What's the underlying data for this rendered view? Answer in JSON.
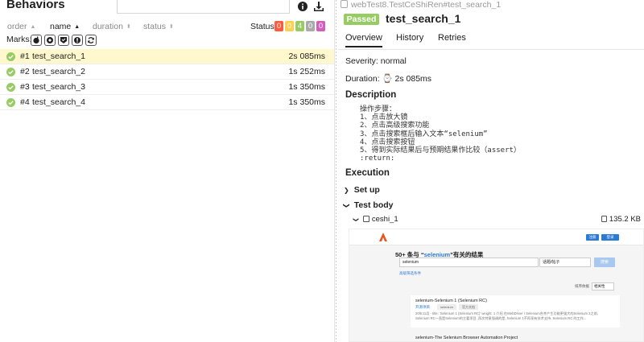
{
  "left": {
    "title": "Behaviors",
    "sort": {
      "order": "order",
      "name": "name",
      "duration": "duration",
      "status": "status"
    },
    "status_label": "Status:",
    "status_counts": [
      {
        "value": "0",
        "color": "#fd5a3e"
      },
      {
        "value": "0",
        "color": "#ffd050"
      },
      {
        "value": "4",
        "color": "#97cc64"
      },
      {
        "value": "0",
        "color": "#aaaaaa"
      },
      {
        "value": "0",
        "color": "#d35ebe"
      }
    ],
    "marks_label": "Marks:",
    "tests": [
      {
        "num": "#1",
        "name": "test_search_1",
        "duration": "2s 085ms",
        "selected": true
      },
      {
        "num": "#2",
        "name": "test_search_2",
        "duration": "1s 252ms",
        "selected": false
      },
      {
        "num": "#3",
        "name": "test_search_3",
        "duration": "1s 350ms",
        "selected": false
      },
      {
        "num": "#4",
        "name": "test_search_4",
        "duration": "1s 350ms",
        "selected": false
      }
    ]
  },
  "right": {
    "breadcrumb": "webTest8.TestCeShiRen#test_search_1",
    "status": "Passed",
    "status_color": "#97cc64",
    "test_name": "test_search_1",
    "tabs": [
      "Overview",
      "History",
      "Retries"
    ],
    "severity": "Severity: normal",
    "duration": "Duration: ⌚ 2s 085ms",
    "description_title": "Description",
    "description": "操作步骤：\n1、点击放大镜\n2、点击高级搜索功能\n3、点击搜索框后输入文本“selenium”\n4、点击搜索按钮\n5、得到实际结果后与预期结果作比较（assert）\n:return:",
    "execution_title": "Execution",
    "setup": "Set up",
    "test_body": "Test body",
    "attachment": {
      "name": "ceshi_1",
      "size": "135.2 KB"
    }
  },
  "screenshot": {
    "btn1": "注册",
    "btn2": "登录",
    "count_prefix": "50+ 条与 “",
    "count_keyword": "selenium",
    "count_suffix": "”有关的结果",
    "search_value": "selenium",
    "type_value": "话题/帖子",
    "search_button": "搜索",
    "advanced_link": "高级筛选条件",
    "sort_label": "排序依据",
    "sort_value": "相关性",
    "result1_title": "selenium-Selenium 1 (Selenium RC)",
    "result1_tag": "开源项目",
    "result1_tag1": "selenium",
    "result1_tag2": "官方文档",
    "result1_snippet": "20年11月 - title: ‘Selenium 1 (Selenium RC)’ weight: 1 介绍 在WebDriver / Selenium合并产生功能更强大的Selenium 2之前, Selenium RC一直是Selenium的主要项目. 再次特意强调的是, Selenium 1不再享有技术支持. Selenium RC 的工作...",
    "result2_title": "selenium-The Selenium Browser Automation Project"
  }
}
